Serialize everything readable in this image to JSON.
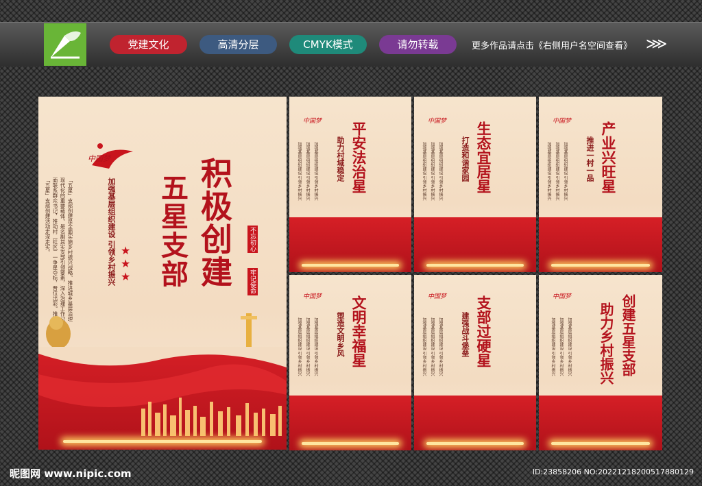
{
  "header": {
    "tags": [
      "党建文化",
      "高清分层",
      "CMYK模式",
      "请勿转载"
    ],
    "notice": "更多作品请点击《右侧用户名空间查看》",
    "arrow": "⋙"
  },
  "main_poster": {
    "title_left": "五星支部",
    "title_right": "积极创建",
    "slogan": "加强基层组织建设 引领乡村振兴",
    "seal_top": "不忘初心",
    "seal_bottom": "牢记使命",
    "body": "「五星」支部创建是全面实施乡村振兴战略、推进城乡基层治理现代化的重要载体。是名副其实支部引领要素，深入治理工作记面联系群众书记，推动村（社区）一争星夺标，晋位出彩。推动「五星」支部创建活动走深走实。"
  },
  "posters": [
    {
      "title": "平安法治星",
      "subtitle": "助力村域稳定"
    },
    {
      "title": "生态宜居星",
      "subtitle": "打造和谐家园"
    },
    {
      "title": "产业兴旺星",
      "subtitle": "推进一村一品"
    },
    {
      "title": "文明幸福星",
      "subtitle": "塑造文明乡风"
    },
    {
      "title": "支部过硬星",
      "subtitle": "建强战斗堡垒"
    },
    {
      "title": "创建五星支部",
      "subtitle": "助力乡村振兴"
    }
  ],
  "small_text": "加强基层组织建设 引领乡村振兴",
  "badge": "中国梦",
  "footer": {
    "site": "昵图网 www.nipic.com",
    "id": "ID:23858206 NO:20221218200517880129"
  },
  "colors": {
    "primary_red": "#c8151d",
    "cream": "#f6e4cd",
    "gold": "#e0a030"
  }
}
